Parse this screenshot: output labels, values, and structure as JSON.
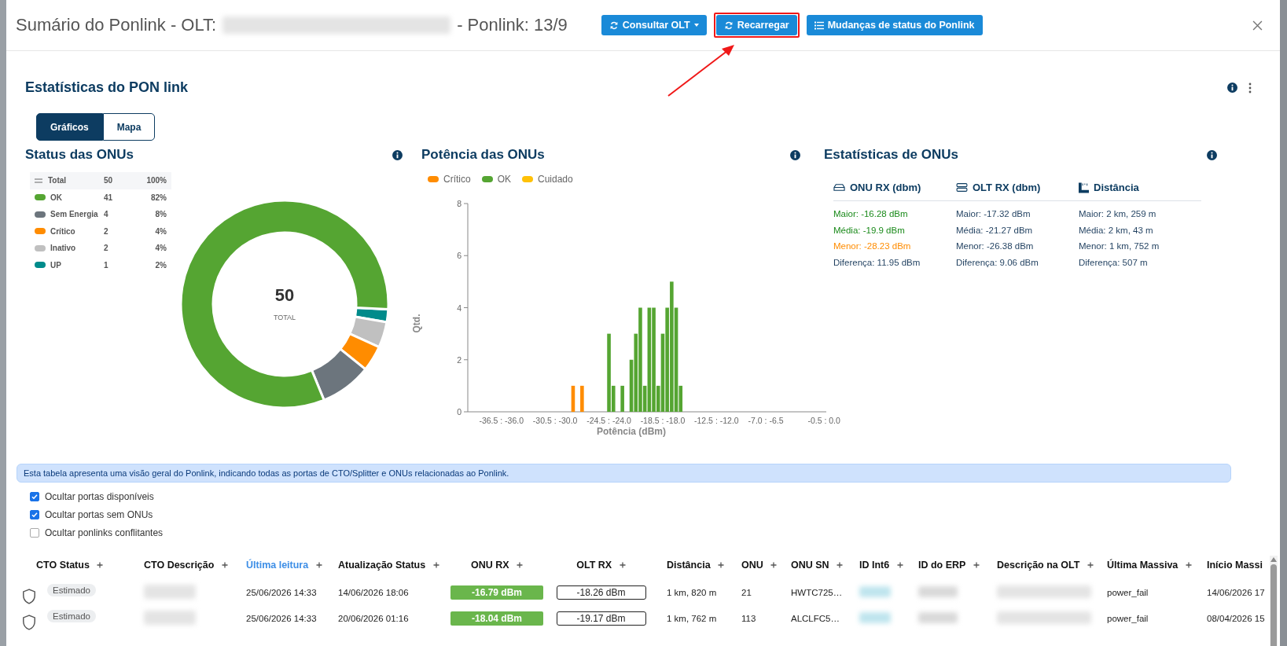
{
  "modal": {
    "title_prefix": "Sumário do Ponlink - OLT:",
    "title_suffix": "- Ponlink: 13/9",
    "buttons": [
      {
        "label": "Consultar OLT",
        "kind": "dropdown",
        "highlighted": false
      },
      {
        "label": "Recarregar",
        "kind": "reload",
        "highlighted": true
      },
      {
        "label": "Mudanças de status do Ponlink",
        "kind": "list",
        "highlighted": false
      }
    ]
  },
  "section_title": "Estatísticas do PON link",
  "view_tabs": [
    {
      "label": "Gráficos",
      "selected": true
    },
    {
      "label": "Mapa",
      "selected": false
    }
  ],
  "status_panel": {
    "title": "Status das ONUs",
    "total": {
      "label": "Total",
      "count": "50",
      "percent": "100%"
    },
    "items": [
      {
        "label": "OK",
        "count": "41",
        "percent": "82%",
        "color": "#55a532"
      },
      {
        "label": "Sem Energia",
        "count": "4",
        "percent": "8%",
        "color": "#6c757d"
      },
      {
        "label": "Crítico",
        "count": "2",
        "percent": "4%",
        "color": "#ff8c00"
      },
      {
        "label": "Inativo",
        "count": "2",
        "percent": "4%",
        "color": "#c0c0c0"
      },
      {
        "label": "UP",
        "count": "1",
        "percent": "2%",
        "color": "#008b8b"
      }
    ],
    "center_value": "50",
    "center_label": "TOTAL"
  },
  "power_panel": {
    "title": "Potência das ONUs",
    "chart_data": {
      "type": "bar",
      "xlabel": "Potência (dBm)",
      "ylabel": "Qtd.",
      "categories": [
        null,
        null,
        null,
        null,
        null,
        null,
        null,
        "-36.5 : -36.0",
        null,
        null,
        null,
        null,
        null,
        null,
        null,
        null,
        null,
        null,
        null,
        "-30.5 : -30.0",
        null,
        null,
        null,
        null,
        null,
        null,
        null,
        null,
        null,
        null,
        null,
        "-24.5 : -24.0",
        null,
        null,
        null,
        null,
        null,
        null,
        null,
        null,
        null,
        null,
        null,
        "-18.5 : -18.0",
        null,
        null,
        null,
        null,
        null,
        null,
        null,
        null,
        null,
        null,
        null,
        "-12.5 : -12.0",
        null,
        null,
        null,
        null,
        null,
        null,
        null,
        null,
        null,
        null,
        "-7.0 : -6.5",
        null,
        null,
        null,
        null,
        null,
        null,
        null,
        null,
        null,
        null,
        null,
        null,
        "-0.5 : 0.0"
      ],
      "series": [
        {
          "name": "Crítico",
          "color": "#ff8c00",
          "values": [
            null,
            null,
            null,
            null,
            null,
            null,
            null,
            null,
            null,
            null,
            null,
            null,
            null,
            null,
            null,
            null,
            null,
            null,
            null,
            null,
            null,
            null,
            null,
            1,
            null,
            1,
            null,
            null,
            null,
            null,
            null,
            null,
            null,
            null,
            null,
            null,
            null,
            null,
            null,
            null,
            null,
            null,
            null,
            null,
            null,
            null,
            null,
            null,
            null,
            null,
            null,
            null,
            null,
            null,
            null,
            null,
            null,
            null,
            null,
            null,
            null,
            null,
            null,
            null,
            null,
            null,
            null,
            null,
            null,
            null,
            null,
            null,
            null,
            null,
            null,
            null,
            null,
            null,
            null,
            null
          ]
        },
        {
          "name": "OK",
          "color": "#55a532",
          "values": [
            null,
            null,
            null,
            null,
            null,
            null,
            null,
            null,
            null,
            null,
            null,
            null,
            null,
            null,
            null,
            null,
            null,
            null,
            null,
            null,
            null,
            null,
            null,
            null,
            null,
            null,
            null,
            null,
            null,
            null,
            null,
            3,
            1,
            null,
            1,
            null,
            2,
            3,
            4,
            1,
            4,
            4,
            1,
            3,
            4,
            5,
            4,
            1,
            null,
            null,
            null,
            null,
            null,
            null,
            null,
            null,
            null,
            null,
            null,
            null,
            null,
            null,
            null,
            null,
            null,
            null,
            null,
            null,
            null,
            null,
            null,
            null,
            null,
            null,
            null,
            null,
            null,
            null,
            null,
            null
          ]
        },
        {
          "name": "Cuidado",
          "color": "#ffc107",
          "values": [
            null,
            null,
            null,
            null,
            null,
            null,
            null,
            null,
            null,
            null,
            null,
            null,
            null,
            null,
            null,
            null,
            null,
            null,
            null,
            null,
            null,
            null,
            null,
            null,
            null,
            null,
            null,
            null,
            null,
            null,
            null,
            null,
            null,
            null,
            null,
            null,
            null,
            null,
            null,
            null,
            null,
            null,
            null,
            null,
            null,
            null,
            null,
            null,
            null,
            null,
            null,
            null,
            null,
            null,
            null,
            null,
            null,
            null,
            null,
            null,
            null,
            null,
            null,
            null,
            null,
            null,
            null,
            null,
            null,
            null,
            null,
            null,
            null,
            null,
            null,
            null,
            null,
            null,
            null,
            null
          ]
        }
      ],
      "ylim": [
        0,
        8
      ],
      "yticks": [
        0,
        2,
        4,
        6,
        8
      ]
    }
  },
  "stats_panel": {
    "title": "Estatísticas de ONUs",
    "columns": [
      {
        "kind": "onu",
        "title": "ONU RX (dbm)",
        "lines": [
          {
            "text": "Maior: -16.28 dBm",
            "color": "#1a8a1a"
          },
          {
            "text": "Média: -19.9 dBm",
            "color": "#1a8a1a"
          },
          {
            "text": "Menor: -28.23 dBm",
            "color": "#ff8c00"
          },
          {
            "text": "Diferença: 11.95 dBm",
            "color": "#1f3f5f"
          }
        ]
      },
      {
        "kind": "olt",
        "title": "OLT RX (dbm)",
        "lines": [
          {
            "text": "Maior: -17.32 dBm",
            "color": "#1f3f5f"
          },
          {
            "text": "Média: -21.27 dBm",
            "color": "#1f3f5f"
          },
          {
            "text": "Menor: -26.38 dBm",
            "color": "#1f3f5f"
          },
          {
            "text": "Diferença: 9.06 dBm",
            "color": "#1f3f5f"
          }
        ]
      },
      {
        "kind": "distance",
        "title": "Distância",
        "lines": [
          {
            "text": "Maior: 2 km, 259 m",
            "color": "#1f3f5f"
          },
          {
            "text": "Média: 2 km, 43 m",
            "color": "#1f3f5f"
          },
          {
            "text": "Menor: 1 km, 752 m",
            "color": "#1f3f5f"
          },
          {
            "text": "Diferença: 507 m",
            "color": "#1f3f5f"
          }
        ]
      }
    ]
  },
  "info_banner": "Esta tabela apresenta uma visão geral do Ponlink, indicando todas as portas de CTO/Splitter e ONUs relacionadas ao Ponlink.",
  "filters": [
    {
      "label": "Ocultar portas disponíveis",
      "checked": true
    },
    {
      "label": "Ocultar portas sem ONUs",
      "checked": true
    },
    {
      "label": "Ocultar ponlinks conflitantes",
      "checked": false
    }
  ],
  "table": {
    "columns": [
      {
        "label": "CTO Status",
        "sorted": false
      },
      {
        "label": "CTO Descrição",
        "sorted": false
      },
      {
        "label": "Última leitura",
        "sorted": true
      },
      {
        "label": "Atualização Status",
        "sorted": false
      },
      {
        "label": "ONU RX",
        "sorted": false
      },
      {
        "label": "OLT RX",
        "sorted": false
      },
      {
        "label": "Distância",
        "sorted": false
      },
      {
        "label": "ONU",
        "sorted": false
      },
      {
        "label": "ONU SN",
        "sorted": false
      },
      {
        "label": "ID Int6",
        "sorted": false
      },
      {
        "label": "ID do ERP",
        "sorted": false
      },
      {
        "label": "Descrição na OLT",
        "sorted": false
      },
      {
        "label": "Última Massiva",
        "sorted": false
      },
      {
        "label": "Início Massi",
        "sorted": false
      }
    ],
    "rows": [
      {
        "cto_status": "Estimado",
        "last_read": "25/06/2026 14:33",
        "status_update": "14/06/2026 18:06",
        "onu_rx": {
          "text": "-16.79 dBm",
          "color": "#6ab64c"
        },
        "olt_rx": "-18.26 dBm",
        "distance": "1 km, 820 m",
        "onu": "21",
        "onu_sn": "HWTC725…",
        "last_massive": "power_fail",
        "massive_start": "14/06/2026 17"
      },
      {
        "cto_status": "Estimado",
        "last_read": "25/06/2026 14:33",
        "status_update": "20/06/2026 01:16",
        "onu_rx": {
          "text": "-18.04 dBm",
          "color": "#6ab64c"
        },
        "olt_rx": "-19.17 dBm",
        "distance": "1 km, 762 m",
        "onu": "113",
        "onu_sn": "ALCLFC5…",
        "last_massive": "power_fail",
        "massive_start": "08/04/2026 15"
      }
    ]
  }
}
